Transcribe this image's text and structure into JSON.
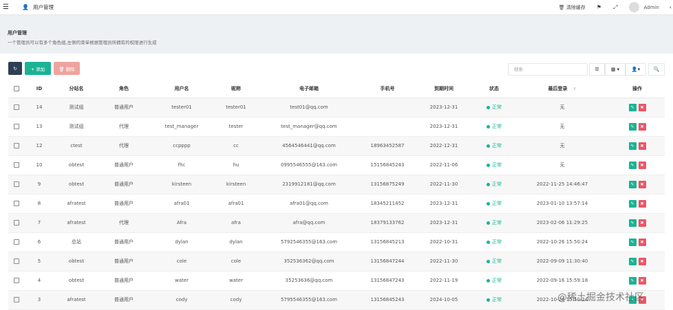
{
  "topbar": {
    "menu_icon": "☰",
    "tab_icon": "user-icon",
    "tab_label": "用户管理",
    "clear_cache": "🗑 清除缓存",
    "user_name": "Admin"
  },
  "header": {
    "title": "用户管理",
    "description": "一个管理员可以有多个角色组,左侧的菜单根据管理员所拥有的权限进行生成"
  },
  "toolbar": {
    "add_label": "+ 添加",
    "delete_label": "🗑 删除",
    "search_placeholder": "搜索"
  },
  "table": {
    "headers": [
      "ID",
      "分站名",
      "角色",
      "用户名",
      "昵称",
      "电子邮箱",
      "手机号",
      "到期时间",
      "状态",
      "最后登录",
      "操作"
    ],
    "rows": [
      {
        "id": "14",
        "site": "测试组",
        "role": "普通用户",
        "username": "tester01",
        "nickname": "tester01",
        "email": "test01@qq.com",
        "phone": "",
        "expire": "2023-12-31",
        "status": "正常",
        "last_login": "无"
      },
      {
        "id": "13",
        "site": "测试组",
        "role": "代理",
        "username": "test_manager",
        "nickname": "tester",
        "email": "test_manager@qq.com",
        "phone": "",
        "expire": "2023-12-31",
        "status": "正常",
        "last_login": "无"
      },
      {
        "id": "12",
        "site": "ctest",
        "role": "代理",
        "username": "ccpppp",
        "nickname": "cc",
        "email": "4564546441@qq.com",
        "phone": "18963452587",
        "expire": "2022-12-31",
        "status": "正常",
        "last_login": "无"
      },
      {
        "id": "10",
        "site": "obtest",
        "role": "普通用户",
        "username": "fhc",
        "nickname": "hu",
        "email": "0995546555@163.com",
        "phone": "15156845243",
        "expire": "2022-11-06",
        "status": "正常",
        "last_login": "无"
      },
      {
        "id": "9",
        "site": "obtest",
        "role": "普通用户",
        "username": "kirsteen",
        "nickname": "kirsteen",
        "email": "2319912181@qq.com",
        "phone": "13156875249",
        "expire": "2022-11-30",
        "status": "正常",
        "last_login": "2022-11-25 14:46:47"
      },
      {
        "id": "8",
        "site": "afratest",
        "role": "普通用户",
        "username": "afra01",
        "nickname": "afra01",
        "email": "afra01@qq.com",
        "phone": "18345211452",
        "expire": "2023-12-31",
        "status": "正常",
        "last_login": "2023-01-10 13:57:14"
      },
      {
        "id": "7",
        "site": "afratest",
        "role": "代理",
        "username": "Afra",
        "nickname": "afra",
        "email": "afra@qq.com",
        "phone": "18379133762",
        "expire": "2023-12-31",
        "status": "正常",
        "last_login": "2023-02-06 11:29:25"
      },
      {
        "id": "6",
        "site": "总站",
        "role": "普通用户",
        "username": "dylan",
        "nickname": "dylan",
        "email": "5792546355@163.com",
        "phone": "13156845213",
        "expire": "2022-10-31",
        "status": "正常",
        "last_login": "2022-10-26 15:50:24"
      },
      {
        "id": "5",
        "site": "obtest",
        "role": "普通用户",
        "username": "cole",
        "nickname": "cole",
        "email": "352536362@qq.com",
        "phone": "13156847244",
        "expire": "2022-11-30",
        "status": "正常",
        "last_login": "2022-09-09 11:30:40"
      },
      {
        "id": "4",
        "site": "obtest",
        "role": "普通用户",
        "username": "water",
        "nickname": "water",
        "email": "35253636@qq.com",
        "phone": "13156847243",
        "expire": "2022-11-19",
        "status": "正常",
        "last_login": "2022-09-16 15:59:18"
      },
      {
        "id": "3",
        "site": "afratest",
        "role": "普通用户",
        "username": "cody",
        "nickname": "cody",
        "email": "5795546355@163.com",
        "phone": "13156845243",
        "expire": "2024-10-05",
        "status": "正常",
        "last_login": "2022-10-26 15:50:24"
      }
    ]
  },
  "watermark": "@稀土掘金技术社区",
  "colors": {
    "success": "#1ab394",
    "danger": "#ed5565",
    "dark": "#2e3e55",
    "header_bg": "#eef1f4"
  }
}
